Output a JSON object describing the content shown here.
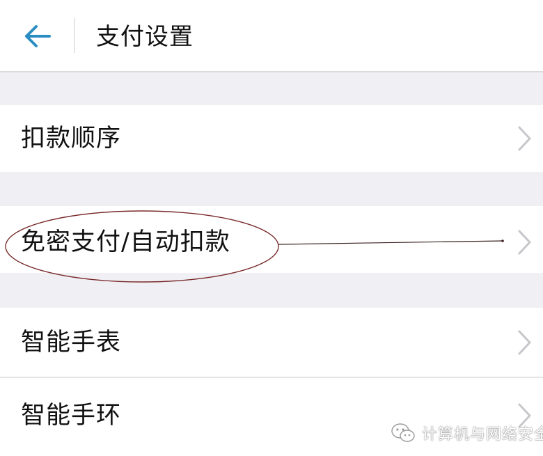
{
  "header": {
    "title": "支付设置",
    "back_icon": "back-arrow-icon",
    "accent_color": "#2b8ec3"
  },
  "settings": {
    "items": [
      {
        "label": "扣款顺序",
        "icon": "chevron-right-icon"
      },
      {
        "label": "免密支付/自动扣款",
        "icon": "chevron-right-icon"
      },
      {
        "label": "智能手表",
        "icon": "chevron-right-icon"
      },
      {
        "label": "智能手环",
        "icon": "chevron-right-icon"
      }
    ]
  },
  "annotation": {
    "shape": "ellipse-with-pointer-line",
    "color": "#7a2a2a"
  },
  "watermark": {
    "icon": "wechat-icon",
    "text": "计算机与网络安全"
  }
}
